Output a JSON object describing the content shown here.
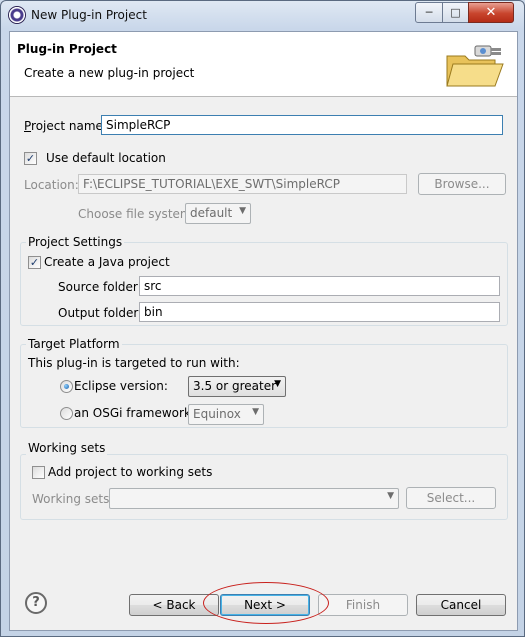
{
  "window": {
    "title": "New Plug-in Project",
    "minimize_label": "─",
    "maximize_label": "□",
    "close_label": "✕"
  },
  "banner": {
    "title": "Plug-in Project",
    "description": "Create a new plug-in project",
    "graphic": "folder-plug-wizard-icon"
  },
  "project": {
    "name_label": "Project name:",
    "name_value": "SimpleRCP",
    "use_default_label": "Use default location",
    "use_default_checked": true,
    "location_label": "Location:",
    "location_value": "F:\\ECLIPSE_TUTORIAL\\EXE_SWT\\SimpleRCP",
    "browse_label": "Browse...",
    "file_system_label": "Choose file system:",
    "file_system_value": "default"
  },
  "project_settings": {
    "group_title": "Project Settings",
    "create_java_label": "Create a Java project",
    "create_java_checked": true,
    "source_label": "Source folder:",
    "source_value": "src",
    "output_label": "Output folder:",
    "output_value": "bin"
  },
  "target_platform": {
    "group_title": "Target Platform",
    "description": "This plug-in is targeted to run with:",
    "eclipse_label": "Eclipse version:",
    "eclipse_selected": true,
    "eclipse_value": "3.5 or greater",
    "osgi_label": "an OSGi framework:",
    "osgi_value": "Equinox"
  },
  "working_sets": {
    "group_title": "Working sets",
    "add_label": "Add project to working sets",
    "add_checked": false,
    "sets_label": "Working sets:",
    "sets_value": "",
    "select_label": "Select..."
  },
  "footer": {
    "help_label": "?",
    "back_label": "< Back",
    "next_label": "Next >",
    "finish_label": "Finish",
    "cancel_label": "Cancel"
  },
  "colors": {
    "annotation_ellipse": "#c8211d",
    "focus_border": "#3c7fb1"
  }
}
